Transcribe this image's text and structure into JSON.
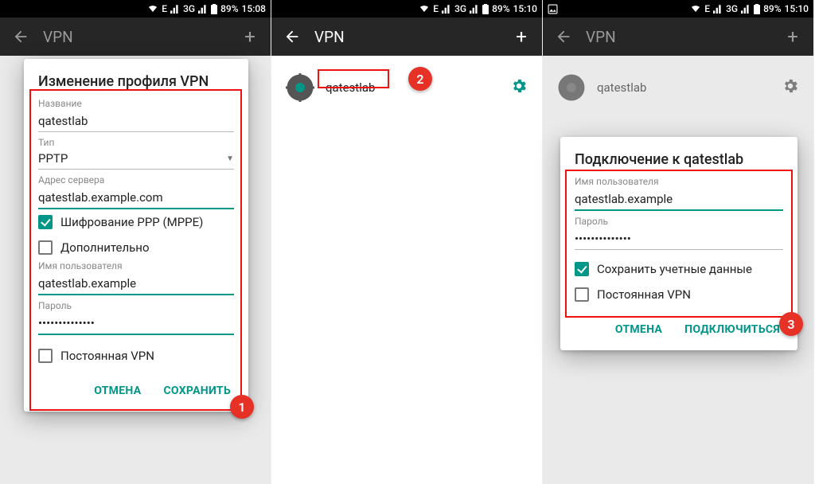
{
  "status": {
    "network": "3G",
    "battery": "89%",
    "time1": "15:08",
    "time2": "15:10",
    "time3": "15:10"
  },
  "appbar": {
    "title": "VPN"
  },
  "vpn_row": {
    "name": "qatestlab"
  },
  "dialog1": {
    "title": "Изменение профиля VPN",
    "name_label": "Название",
    "name_value": "qatestlab",
    "type_label": "Тип",
    "type_value": "PPTP",
    "server_label": "Адрес сервера",
    "server_value": "qatestlab.example.com",
    "cb_mppe": "Шифрование PPP (MPPE)",
    "cb_advanced": "Дополнительно",
    "user_label": "Имя пользователя",
    "user_value": "qatestlab.example",
    "pass_label": "Пароль",
    "pass_value": "••••••••••••••",
    "cb_always": "Постоянная VPN",
    "cancel": "ОТМЕНА",
    "save": "СОХРАНИТЬ"
  },
  "dialog3": {
    "title": "Подключение к qatestlab",
    "user_label": "Имя пользователя",
    "user_value": "qatestlab.example",
    "pass_label": "Пароль",
    "pass_value": "••••••••••••••",
    "cb_save": "Сохранить учетные данные",
    "cb_always": "Постоянная VPN",
    "cancel": "ОТМЕНА",
    "connect": "ПОДКЛЮЧИТЬСЯ"
  },
  "badges": {
    "b1": "1",
    "b2": "2",
    "b3": "3"
  }
}
